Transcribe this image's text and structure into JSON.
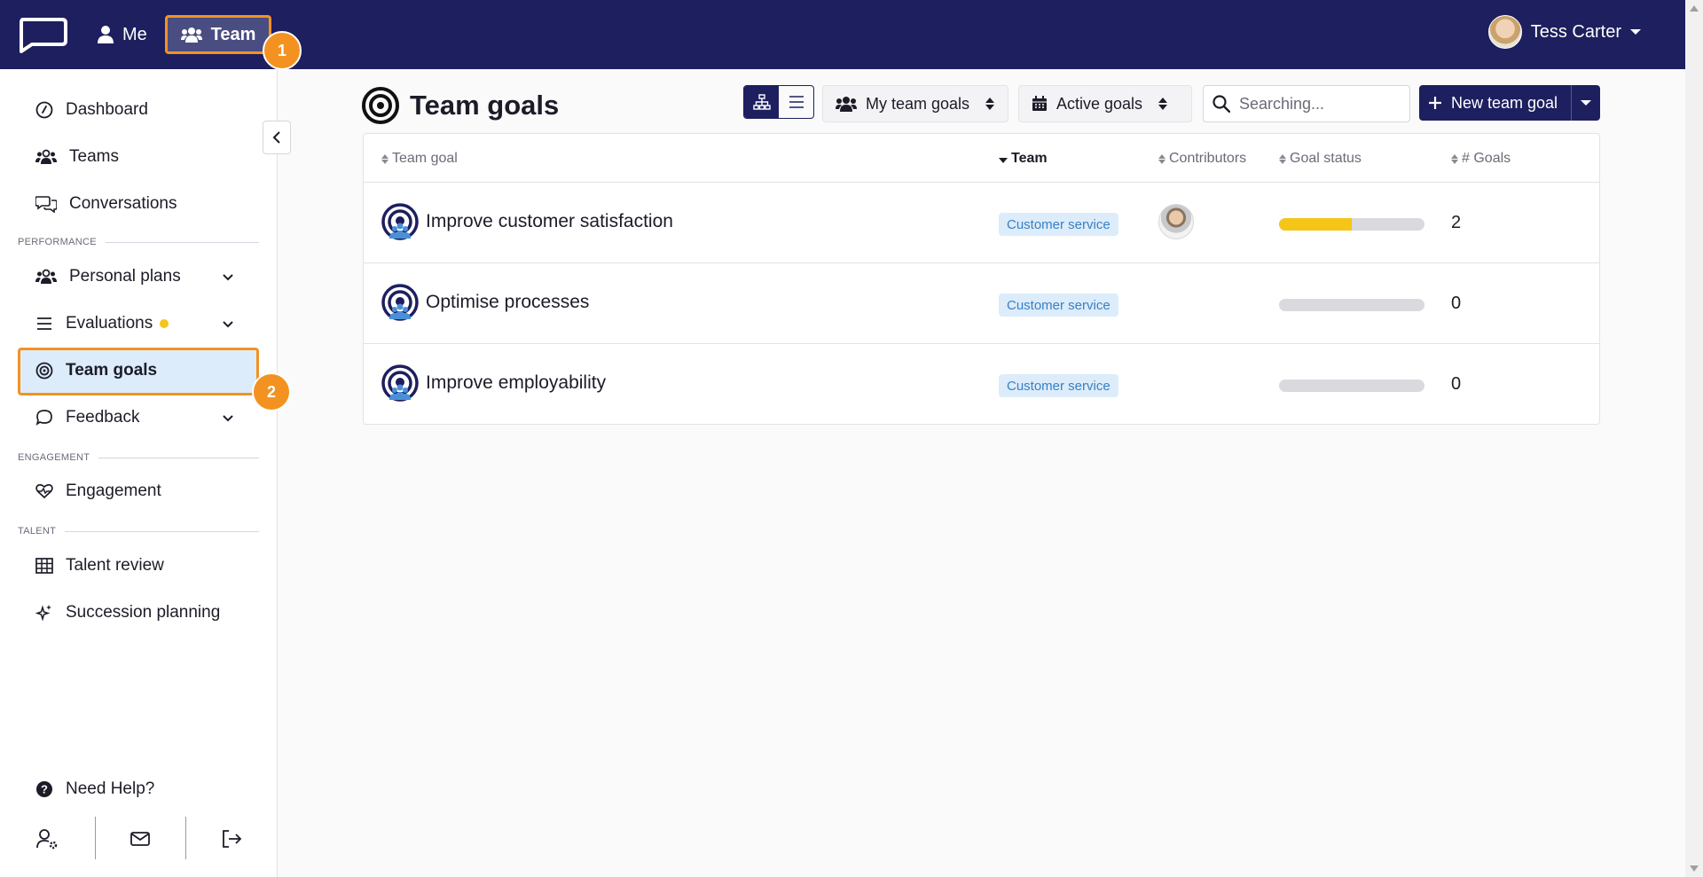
{
  "topbar": {
    "nav_me": "Me",
    "nav_team": "Team",
    "user_name": "Tess Carter",
    "step1": "1"
  },
  "sidebar": {
    "dashboard": "Dashboard",
    "teams": "Teams",
    "conversations": "Conversations",
    "section_performance": "PERFORMANCE",
    "personal_plans": "Personal plans",
    "evaluations": "Evaluations",
    "team_goals": "Team goals",
    "step2": "2",
    "feedback": "Feedback",
    "section_engagement": "ENGAGEMENT",
    "engagement": "Engagement",
    "section_talent": "TALENT",
    "talent_review": "Talent review",
    "succession_planning": "Succession planning",
    "need_help": "Need Help?"
  },
  "main": {
    "title": "Team goals",
    "filter_team": "My team goals",
    "filter_status": "Active goals",
    "search_placeholder": "Searching...",
    "new_button": "New team goal",
    "columns": {
      "goal": "Team goal",
      "team": "Team",
      "contributors": "Contributors",
      "status": "Goal status",
      "count": "# Goals"
    },
    "rows": [
      {
        "name": "Improve customer satisfaction",
        "team": "Customer service",
        "progress": 0.5,
        "goals": "2",
        "has_contributor": true
      },
      {
        "name": "Optimise processes",
        "team": "Customer service",
        "progress": 0,
        "goals": "0",
        "has_contributor": false
      },
      {
        "name": "Improve employability",
        "team": "Customer service",
        "progress": 0,
        "goals": "0",
        "has_contributor": false
      }
    ]
  },
  "colors": {
    "navy": "#1d1f5e",
    "accent_orange": "#f39221",
    "progress_yellow": "#f5c518",
    "pill_bg": "#dcecfa",
    "pill_text": "#3a80c2"
  }
}
